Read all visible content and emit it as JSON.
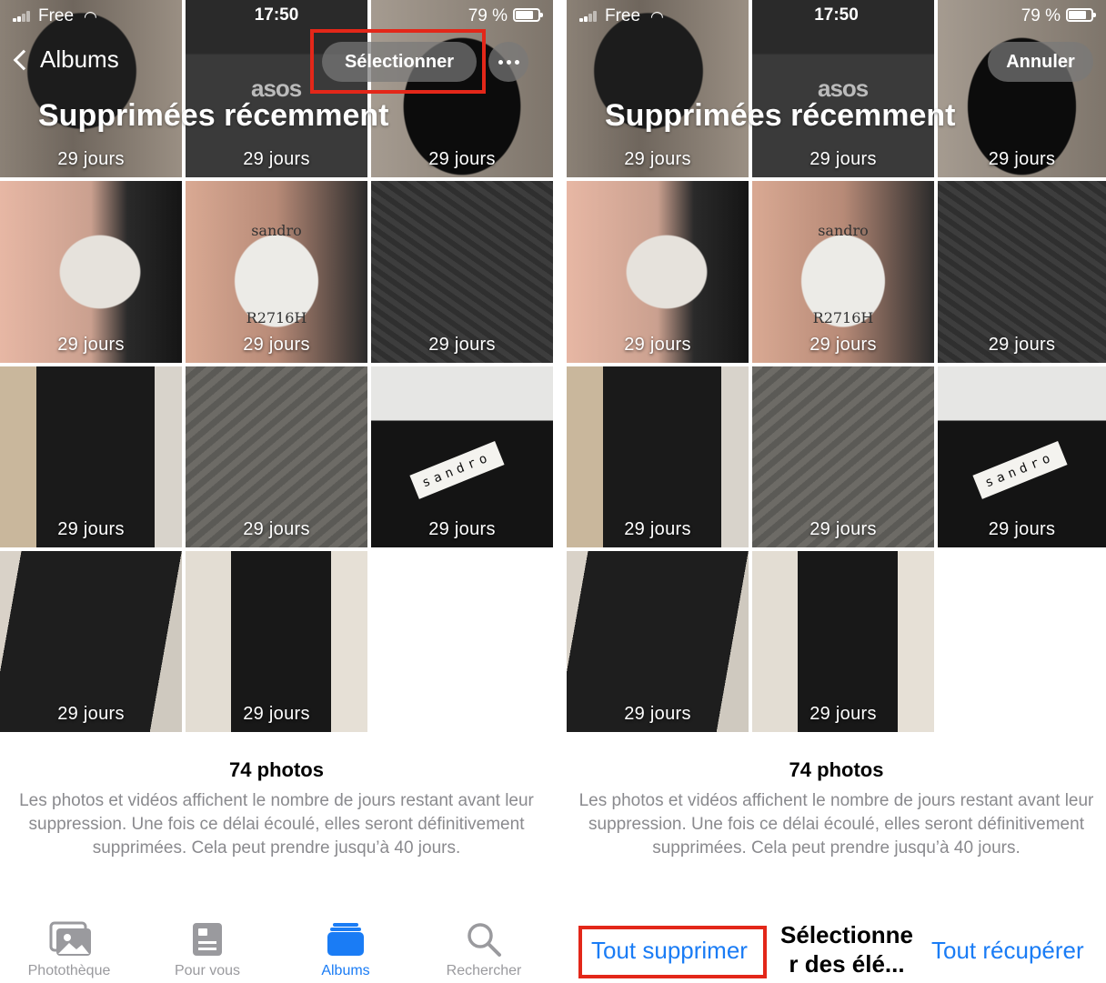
{
  "status_bar": {
    "carrier": "Free",
    "time": "17:50",
    "battery_percent": "79 %",
    "battery_level": 0.79
  },
  "left_screen": {
    "nav": {
      "back_label": "Albums",
      "select_button": "Sélectionner",
      "more_icon": "ellipsis-icon"
    },
    "title": "Supprimées récemment",
    "thumbnail_badge": "29 jours",
    "summary": {
      "count": "74 photos",
      "description": "Les photos et vidéos affichent le nombre de jours restant avant leur suppression. Une fois ce délai écoulé, elles seront définitivement supprimées. Cela peut prendre jusqu’à 40 jours."
    },
    "tab_bar": [
      {
        "label": "Photothèque",
        "icon": "photo-library-icon",
        "active": false
      },
      {
        "label": "Pour vous",
        "icon": "for-you-icon",
        "active": false
      },
      {
        "label": "Albums",
        "icon": "albums-icon",
        "active": true
      },
      {
        "label": "Rechercher",
        "icon": "search-icon",
        "active": false
      }
    ]
  },
  "right_screen": {
    "nav": {
      "cancel_button": "Annuler"
    },
    "title": "Supprimées récemment",
    "thumbnail_badge": "29 jours",
    "summary": {
      "count": "74 photos",
      "description": "Les photos et vidéos affichent le nombre de jours restant avant leur suppression. Une fois ce délai écoulé, elles seront définitivement supprimées. Cela peut prendre jusqu’à 40 jours."
    },
    "actions": {
      "delete_all": "Tout supprimer",
      "select_items_line1": "Sélectionne",
      "select_items_line2": "r des élé...",
      "recover_all": "Tout récupérer"
    }
  },
  "thumbnail_text": {
    "asos_logo": "asos",
    "sandro_label": "sandro",
    "care_label_brand": "sandro",
    "care_label_ref": "R2716H"
  },
  "colors": {
    "accent": "#1a7cf5",
    "highlight": "#e32719",
    "secondary_text": "#8a8a8e"
  }
}
